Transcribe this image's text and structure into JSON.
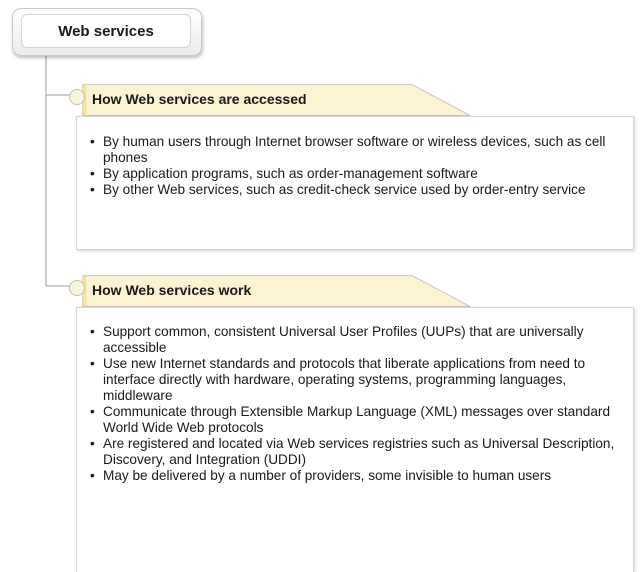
{
  "root": {
    "title": "Web services"
  },
  "sections": [
    {
      "title": "How Web services are accessed",
      "items": [
        "By human users through Internet browser software or wireless devices, such as cell phones",
        "By application programs, such as order-management software",
        "By other Web services, such as credit-check service used by order-entry service"
      ]
    },
    {
      "title": "How Web services work",
      "items": [
        "Support common, consistent Universal User Profiles (UUPs) that are universally accessible",
        "Use new Internet standards and protocols that liberate applications from need to interface directly with hardware, operating systems, programming languages, middleware",
        "Communicate through Extensible Markup Language (XML) messages over standard World Wide Web protocols",
        "Are registered and located via Web services registries such as Universal Description, Discovery, and Integration (UDDI)",
        "May be delivered by a number of providers, some invisible to human users"
      ]
    }
  ],
  "colors": {
    "header_fill": "#fbf3d2",
    "header_border": "#c8c8c8",
    "connector": "#9a9a9a"
  }
}
